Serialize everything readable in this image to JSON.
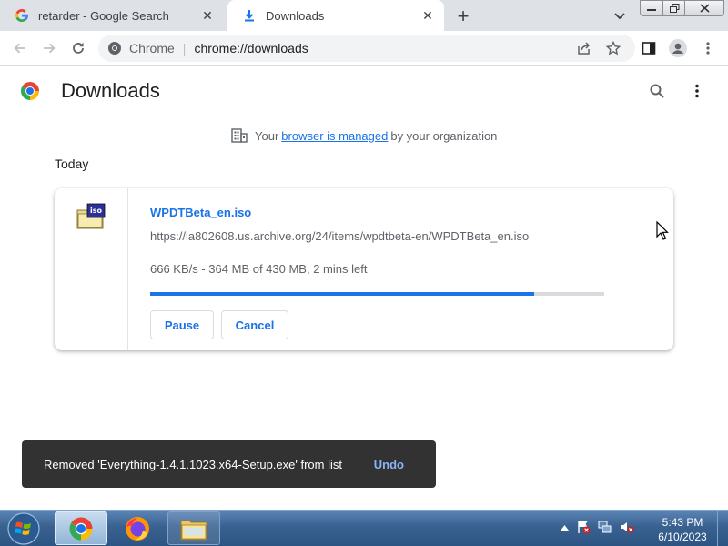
{
  "browser": {
    "tabs": [
      {
        "title": "retarder - Google Search",
        "icon": "google-g-icon",
        "active": false
      },
      {
        "title": "Downloads",
        "icon": "download-icon",
        "active": true
      }
    ],
    "new_tab_label": "+",
    "omnibox": {
      "site_label": "Chrome",
      "url": "chrome://downloads"
    }
  },
  "page": {
    "title": "Downloads",
    "managed_notice": {
      "before": "Your",
      "link": "browser is managed",
      "after": "by your organization"
    },
    "date_header": "Today"
  },
  "download": {
    "file_name": "WPDTBeta_en.iso",
    "icon_label": "iso",
    "url": "https://ia802608.us.archive.org/24/items/wpdtbeta-en/WPDTBeta_en.iso",
    "status": "666 KB/s - 364 MB of 430 MB, 2 mins left",
    "progress_fraction": 0.8465,
    "pause_label": "Pause",
    "cancel_label": "Cancel"
  },
  "toast": {
    "message": "Removed 'Everything-1.4.1.1023.x64-Setup.exe' from list",
    "undo_label": "Undo"
  },
  "taskbar": {
    "apps": [
      "chrome",
      "firefox",
      "file-explorer"
    ],
    "time": "5:43 PM",
    "date": "6/10/2023"
  },
  "colors": {
    "accent": "#1a73e8",
    "tabstrip": "#dee1e6",
    "toast_bg": "#323232",
    "undo": "#8ab4f8"
  }
}
